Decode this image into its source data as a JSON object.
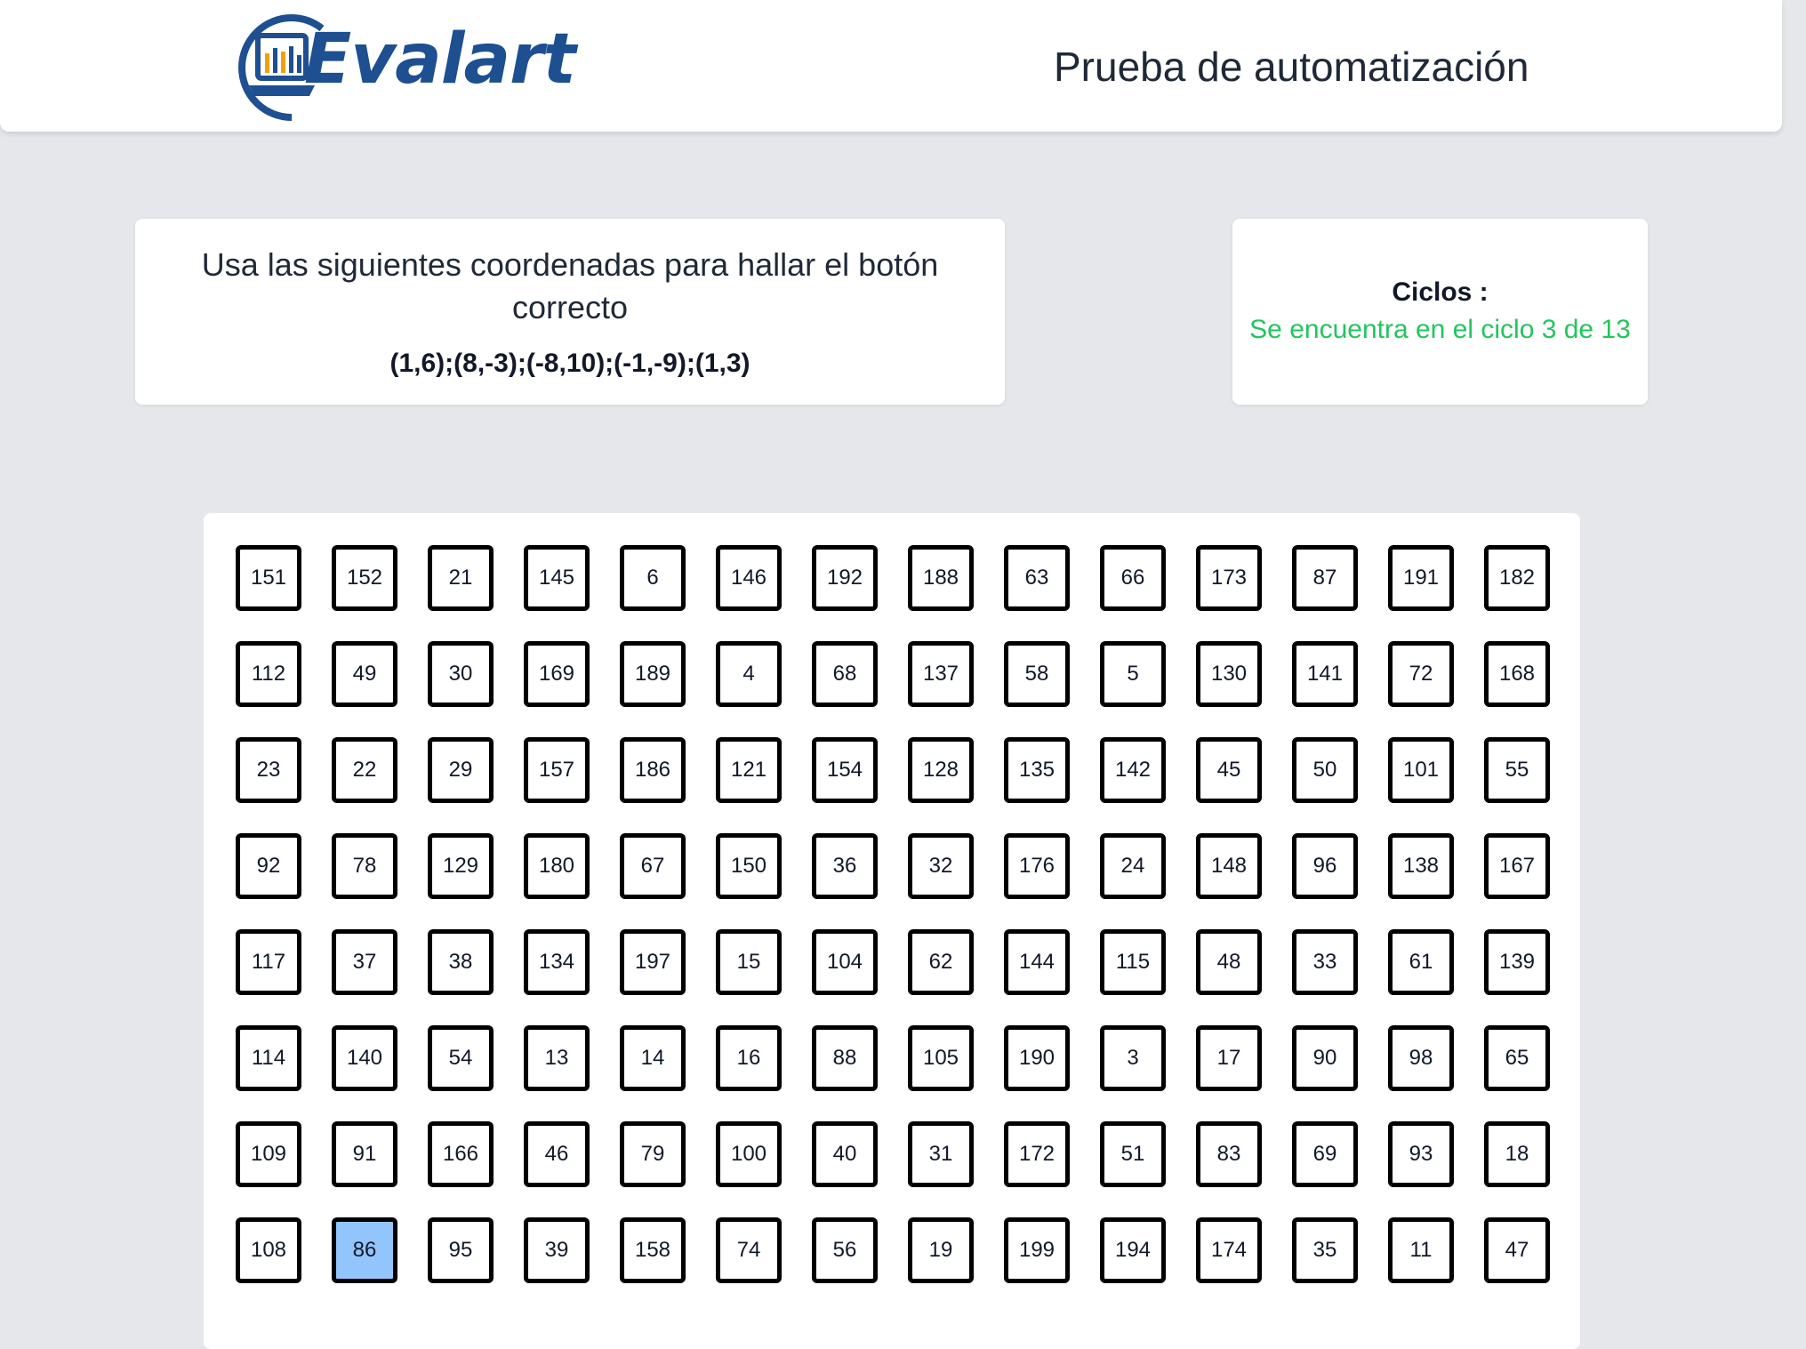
{
  "header": {
    "logo_text": "Evalart",
    "title": "Prueba de automatización",
    "brand_color": "#1d4f91"
  },
  "instructions": {
    "text": "Usa las siguientes coordenadas para hallar el botón correcto",
    "coordinates": "(1,6);(8,-3);(-8,10);(-1,-9);(1,3)"
  },
  "cycles": {
    "label": "Ciclos :",
    "status": "Se encuentra en el ciclo 3 de 13",
    "status_color": "#22c55e"
  },
  "grid": {
    "selected_value": "86",
    "selected_color": "#93c5fd",
    "rows": [
      [
        "151",
        "152",
        "21",
        "145",
        "6",
        "146",
        "192",
        "188",
        "63",
        "66",
        "173",
        "87",
        "191",
        "182"
      ],
      [
        "112",
        "49",
        "30",
        "169",
        "189",
        "4",
        "68",
        "137",
        "58",
        "5",
        "130",
        "141",
        "72",
        "168"
      ],
      [
        "23",
        "22",
        "29",
        "157",
        "186",
        "121",
        "154",
        "128",
        "135",
        "142",
        "45",
        "50",
        "101",
        "55"
      ],
      [
        "92",
        "78",
        "129",
        "180",
        "67",
        "150",
        "36",
        "32",
        "176",
        "24",
        "148",
        "96",
        "138",
        "167"
      ],
      [
        "117",
        "37",
        "38",
        "134",
        "197",
        "15",
        "104",
        "62",
        "144",
        "115",
        "48",
        "33",
        "61",
        "139"
      ],
      [
        "114",
        "140",
        "54",
        "13",
        "14",
        "16",
        "88",
        "105",
        "190",
        "3",
        "17",
        "90",
        "98",
        "65"
      ],
      [
        "109",
        "91",
        "166",
        "46",
        "79",
        "100",
        "40",
        "31",
        "172",
        "51",
        "83",
        "69",
        "93",
        "18"
      ],
      [
        "108",
        "86",
        "95",
        "39",
        "158",
        "74",
        "56",
        "19",
        "199",
        "194",
        "174",
        "35",
        "11",
        "47"
      ]
    ]
  }
}
